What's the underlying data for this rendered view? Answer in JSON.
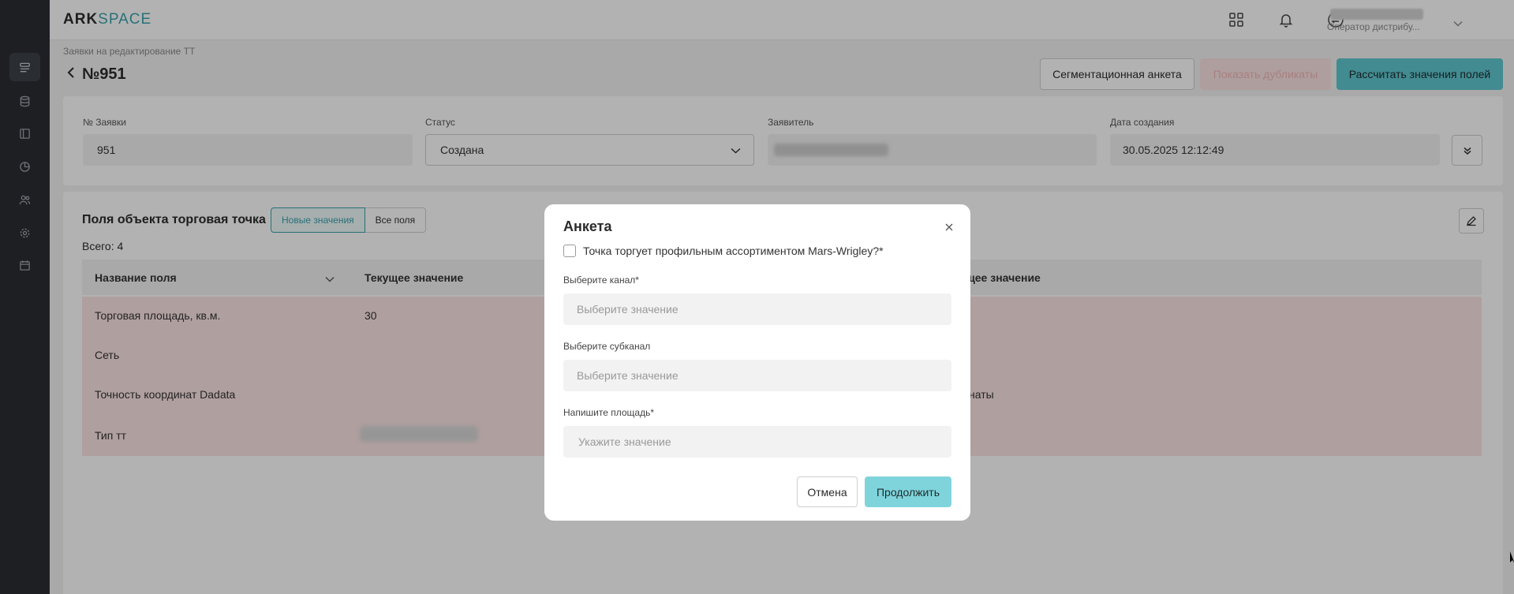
{
  "app": {
    "logo_part1": "ARK",
    "logo_part2": "SPACE"
  },
  "sidebar": {
    "items": [
      {
        "icon": "list-icon",
        "active": true
      },
      {
        "icon": "database-icon",
        "active": false
      },
      {
        "icon": "layout-icon",
        "active": false
      },
      {
        "icon": "pie-chart-icon",
        "active": false
      },
      {
        "icon": "users-icon",
        "active": false
      },
      {
        "icon": "gear-icon",
        "active": false
      },
      {
        "icon": "calendar-icon",
        "active": false
      }
    ]
  },
  "topbar": {
    "icons": [
      "grid-icon",
      "bell-icon",
      "sync-icon"
    ],
    "user_role": "Оператор дистрибу..."
  },
  "header": {
    "breadcrumb": "Заявки на редактирование ТТ",
    "title": "№951",
    "btn_segment": "Сегментационная анкета",
    "btn_duplicates": "Показать дубликаты",
    "btn_calculate": "Рассчитать значения полей"
  },
  "info": {
    "number_label": "№ Заявки",
    "number_value": "951",
    "status_label": "Статус",
    "status_value": "Создана",
    "applicant_label": "Заявитель",
    "date_label": "Дата создания",
    "date_value": "30.05.2025 12:12:49"
  },
  "fields": {
    "title": "Поля объекта торговая точка",
    "tab_new": "Новые значения",
    "tab_all": "Все поля",
    "total": "Всего: 4",
    "columns": [
      "Название поля",
      "Текущее значение",
      "ющее значение"
    ],
    "rows": [
      {
        "name": "Торговая площадь, кв.м.",
        "current": "30",
        "new": ""
      },
      {
        "name": "Сеть",
        "current": "",
        "new": ""
      },
      {
        "name": "Точность координат Dadata",
        "current": "",
        "new": "динаты"
      },
      {
        "name": "Тип тт",
        "current": "",
        "new": ""
      }
    ]
  },
  "modal": {
    "title": "Анкета",
    "checkbox_label": "Точка торгует профильным ассортиментом Mars-Wrigley?*",
    "channel_label": "Выберите канал*",
    "channel_placeholder": "Выберите значение",
    "subchannel_label": "Выберите субканал",
    "subchannel_placeholder": "Выберите значение",
    "area_label": "Напишите площадь*",
    "area_placeholder": "Укажите значение",
    "cancel": "Отмена",
    "continue": "Продолжить"
  }
}
